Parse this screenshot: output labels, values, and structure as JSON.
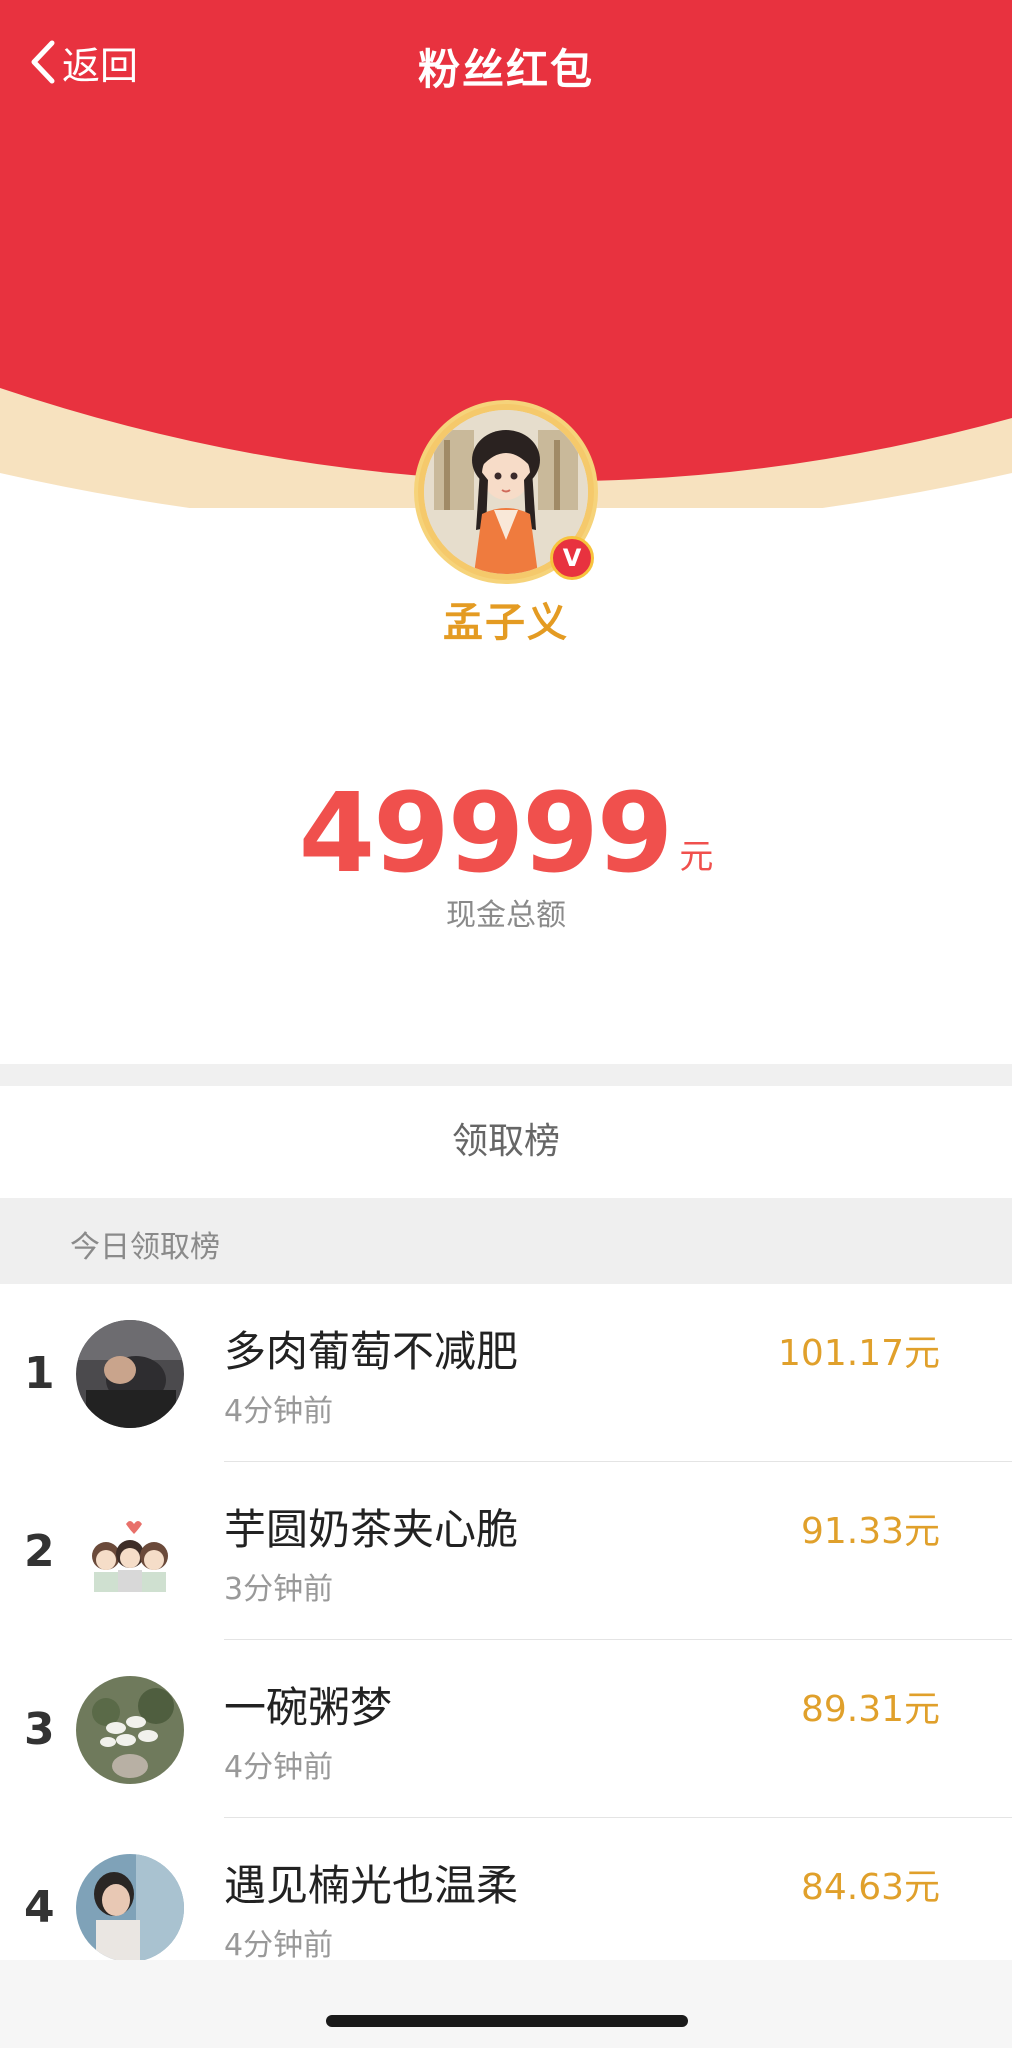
{
  "nav": {
    "back_label": "返回",
    "title": "粉丝红包"
  },
  "colors": {
    "brand_red": "#e8323f",
    "gold": "#e49b22",
    "amount_red": "#f0504d",
    "money_gold": "#e0a02b"
  },
  "profile": {
    "name": "孟子义",
    "verified_badge": "V"
  },
  "total": {
    "amount": "49999",
    "unit": "元",
    "label": "现金总额"
  },
  "board": {
    "title": "领取榜",
    "section_label": "今日领取榜"
  },
  "ranking": [
    {
      "rank": "1",
      "name": "多肉葡萄不减肥",
      "time": "4分钟前",
      "amount": "101.17元"
    },
    {
      "rank": "2",
      "name": "芋圆奶茶夹心脆",
      "time": "3分钟前",
      "amount": "91.33元"
    },
    {
      "rank": "3",
      "name": "一碗粥梦",
      "time": "4分钟前",
      "amount": "89.31元"
    },
    {
      "rank": "4",
      "name": "遇见楠光也温柔",
      "time": "4分钟前",
      "amount": "84.63元"
    }
  ],
  "icons": {
    "back": "chevron-left-icon",
    "verified": "verified-v-icon"
  }
}
